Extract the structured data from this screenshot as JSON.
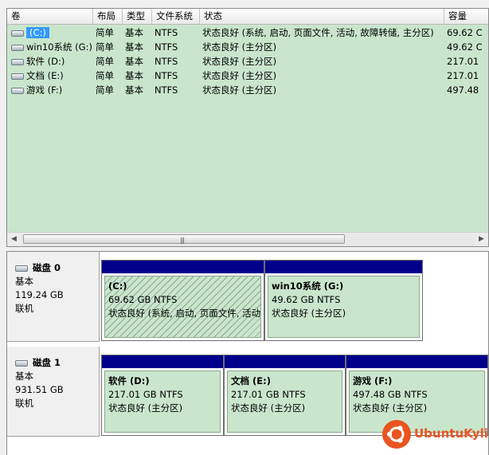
{
  "volume_list": {
    "columns": [
      {
        "key": "volume",
        "label": "卷"
      },
      {
        "key": "layout",
        "label": "布局"
      },
      {
        "key": "type",
        "label": "类型"
      },
      {
        "key": "filesystem",
        "label": "文件系统"
      },
      {
        "key": "status",
        "label": "状态"
      },
      {
        "key": "capacity",
        "label": "容量"
      }
    ],
    "rows": [
      {
        "volume": "(C:)",
        "layout": "简单",
        "type": "基本",
        "filesystem": "NTFS",
        "status": "状态良好 (系统, 启动, 页面文件, 活动, 故障转储, 主分区)",
        "capacity": "69.62 C",
        "selected": true
      },
      {
        "volume": "win10系统 (G:)",
        "layout": "简单",
        "type": "基本",
        "filesystem": "NTFS",
        "status": "状态良好 (主分区)",
        "capacity": "49.62 C"
      },
      {
        "volume": "软件 (D:)",
        "layout": "简单",
        "type": "基本",
        "filesystem": "NTFS",
        "status": "状态良好 (主分区)",
        "capacity": "217.01"
      },
      {
        "volume": "文档 (E:)",
        "layout": "简单",
        "type": "基本",
        "filesystem": "NTFS",
        "status": "状态良好 (主分区)",
        "capacity": "217.01"
      },
      {
        "volume": "游戏 (F:)",
        "layout": "简单",
        "type": "基本",
        "filesystem": "NTFS",
        "status": "状态良好 (主分区)",
        "capacity": "497.48"
      }
    ],
    "scrollbar": {
      "left_arrow": "◀",
      "right_arrow": "▶",
      "grip": "|||"
    }
  },
  "disks": [
    {
      "name": "磁盘 0",
      "type": "基本",
      "size": "119.24 GB",
      "state": "联机",
      "partitions": [
        {
          "name": "(C:)",
          "size": "69.62 GB NTFS",
          "status": "状态良好 (系统, 启动, 页面文件, 活动, 故障转储, 主分区)",
          "selected": true
        },
        {
          "name": "win10系统  (G:)",
          "size": "49.62 GB NTFS",
          "status": "状态良好 (主分区)"
        }
      ]
    },
    {
      "name": "磁盘 1",
      "type": "基本",
      "size": "931.51 GB",
      "state": "联机",
      "partitions": [
        {
          "name": "软件  (D:)",
          "size": "217.01 GB NTFS",
          "status": "状态良好 (主分区)"
        },
        {
          "name": "文档  (E:)",
          "size": "217.01 GB NTFS",
          "status": "状态良好 (主分区)"
        },
        {
          "name": "游戏  (F:)",
          "size": "497.48 GB NTFS",
          "status": "状态良好 (主分区)"
        }
      ]
    }
  ],
  "watermark": {
    "text": "UbuntuKylin",
    "icon": "ubuntu-kylin-logo-icon",
    "color": "#e95420"
  },
  "colors": {
    "partition_fill": "#c9e6cc",
    "partition_bar": "#00008b",
    "selection": "#3399ff"
  }
}
